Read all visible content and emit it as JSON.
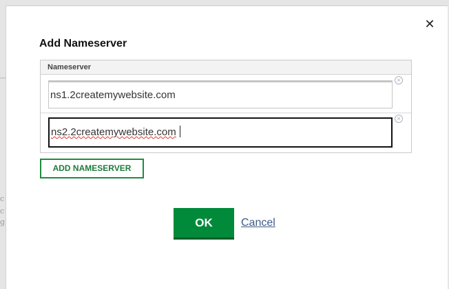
{
  "dialog": {
    "title": "Add Nameserver",
    "close_glyph": "✕",
    "table_header": "Nameserver",
    "nameservers": [
      {
        "value": "ns1.2createmywebsite.com",
        "focused": false
      },
      {
        "value": "ns2.2createmywebsite.com",
        "focused": true
      }
    ],
    "remove_glyph": "×",
    "add_button_label": "ADD NAMESERVER",
    "ok_label": "OK",
    "cancel_label": "Cancel"
  },
  "background": {
    "fragments": [
      "c",
      "c",
      "g"
    ]
  },
  "colors": {
    "accent_green": "#008a3a",
    "link_blue": "#3b5a86"
  },
  "icons": {
    "close": "close-icon",
    "remove": "remove-circle-icon"
  }
}
